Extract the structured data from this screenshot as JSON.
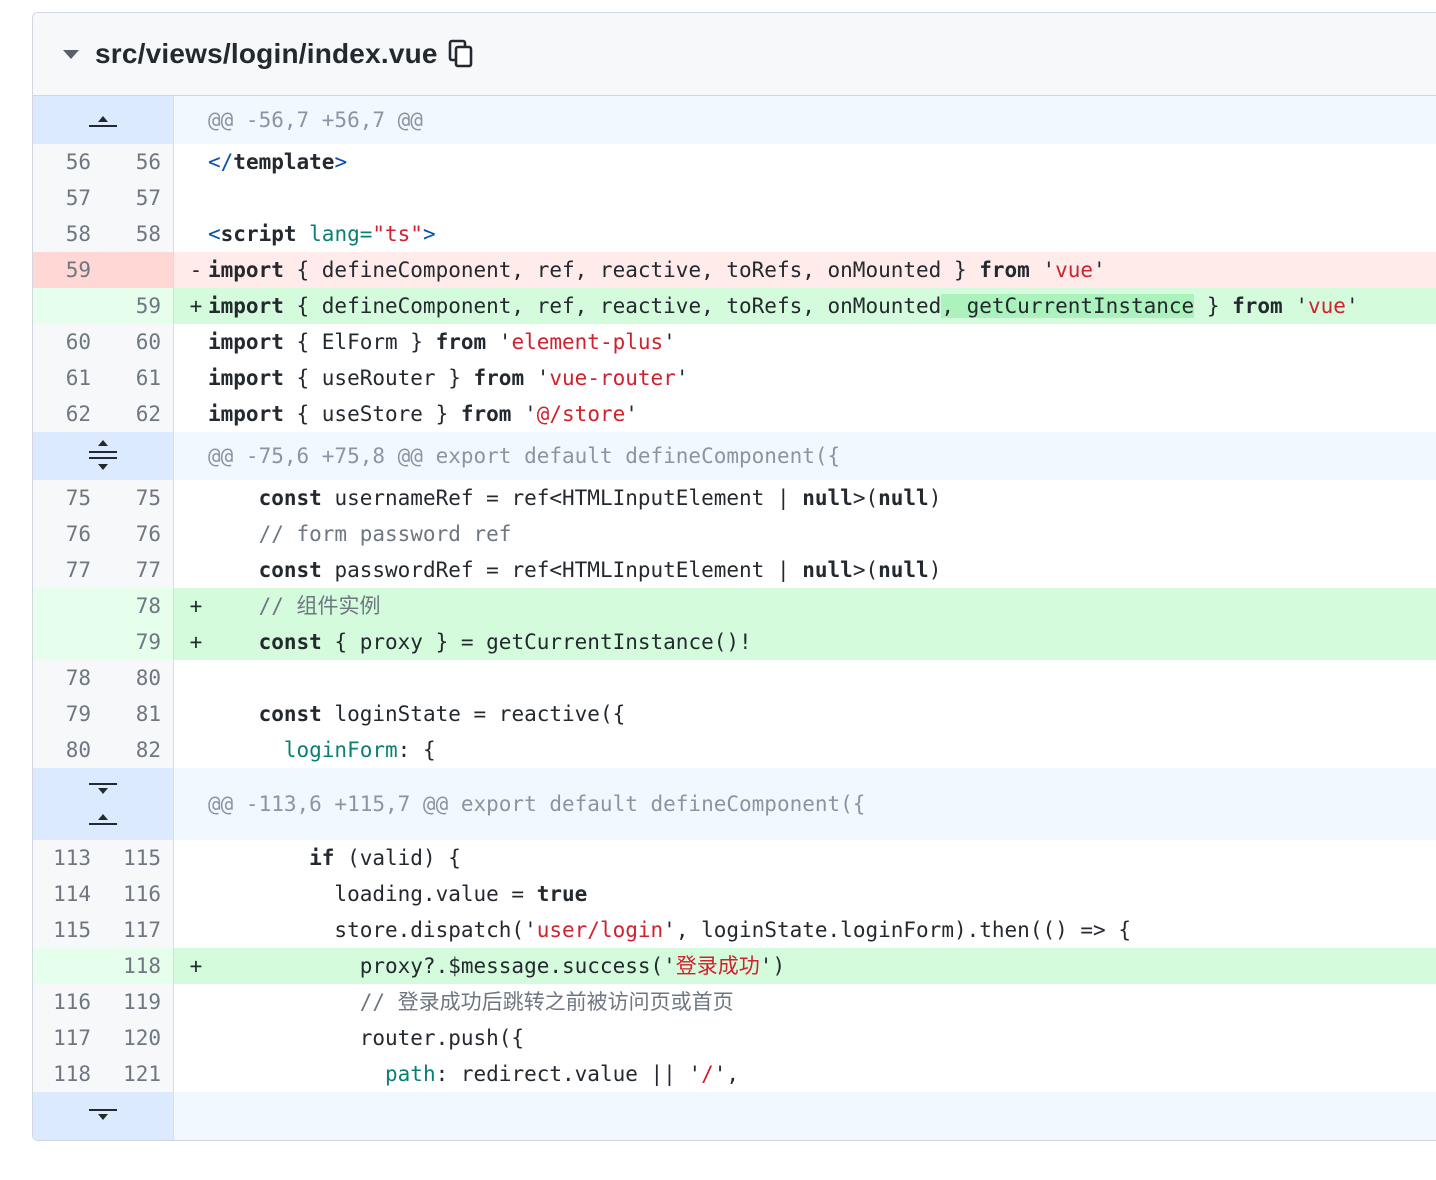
{
  "file": {
    "path": "src/views/login/index.vue",
    "hunks": {
      "h1": "@@ -56,7 +56,7 @@",
      "h2": "@@ -75,6 +75,8 @@ export default defineComponent({",
      "h3": "@@ -113,6 +115,7 @@ export default defineComponent({"
    },
    "lines": [
      {
        "old": "56",
        "new": "56"
      },
      {
        "old": "57",
        "new": "57"
      },
      {
        "old": "58",
        "new": "58"
      },
      {
        "old": "59",
        "new": ""
      },
      {
        "old": "",
        "new": "59"
      },
      {
        "old": "60",
        "new": "60"
      },
      {
        "old": "61",
        "new": "61"
      },
      {
        "old": "62",
        "new": "62"
      },
      {
        "old": "75",
        "new": "75"
      },
      {
        "old": "76",
        "new": "76"
      },
      {
        "old": "77",
        "new": "77"
      },
      {
        "old": "",
        "new": "78"
      },
      {
        "old": "",
        "new": "79"
      },
      {
        "old": "78",
        "new": "80"
      },
      {
        "old": "79",
        "new": "81"
      },
      {
        "old": "80",
        "new": "82"
      },
      {
        "old": "113",
        "new": "115"
      },
      {
        "old": "114",
        "new": "116"
      },
      {
        "old": "115",
        "new": "117"
      },
      {
        "old": "",
        "new": "118"
      },
      {
        "old": "116",
        "new": "119"
      },
      {
        "old": "117",
        "new": "120"
      },
      {
        "old": "118",
        "new": "121"
      }
    ],
    "code": {
      "l56_a": "</",
      "l56_b": "template",
      "l56_c": ">",
      "l58_a": "<",
      "l58_b": "script",
      "l58_c": " lang=",
      "l58_d": "\"ts\"",
      "l58_e": ">",
      "l59d_kw": "import",
      "l59d_mid": " { defineComponent, ref, reactive, toRefs, onMounted } ",
      "l59d_from": "from",
      "l59d_q1": " '",
      "l59d_str": "vue",
      "l59d_q2": "'",
      "l59a_kw": "import",
      "l59a_mid": " { defineComponent, ref, reactive, toRefs, onMounted",
      "l59a_hl": ", getCurrentInstance",
      "l59a_mid2": " } ",
      "l59a_from": "from",
      "l59a_q1": " '",
      "l59a_str": "vue",
      "l59a_q2": "'",
      "l60_kw": "import",
      "l60_mid": " { ElForm } ",
      "l60_from": "from",
      "l60_q1": " '",
      "l60_str": "element-plus",
      "l60_q2": "'",
      "l61_kw": "import",
      "l61_mid": " { useRouter } ",
      "l61_from": "from",
      "l61_q1": " '",
      "l61_str": "vue-router",
      "l61_q2": "'",
      "l62_kw": "import",
      "l62_mid": " { useStore } ",
      "l62_from": "from",
      "l62_q1": " '",
      "l62_str": "@/store",
      "l62_q2": "'",
      "l75_ind": "    ",
      "l75_kw": "const",
      "l75_mid": " usernameRef = ref<HTMLInputElement | ",
      "l75_null": "null",
      "l75_p": ">(",
      "l75_null2": "null",
      "l75_e": ")",
      "l76": "    // form password ref",
      "l77_ind": "    ",
      "l77_kw": "const",
      "l77_mid": " passwordRef = ref<HTMLInputElement | ",
      "l77_null": "null",
      "l77_p": ">(",
      "l77_null2": "null",
      "l77_e": ")",
      "l78n": "    // 组件实例",
      "l79n_ind": "    ",
      "l79n_kw": "const",
      "l79n_mid": " { proxy } = getCurrentInstance()!",
      "l81_ind": "    ",
      "l81_kw": "const",
      "l81_mid": " loginState = reactive({",
      "l82_ind": "      ",
      "l82_prop": "loginForm",
      "l82_mid": ": {",
      "l115_ind": "        ",
      "l115_kw": "if",
      "l115_mid": " (valid) {",
      "l116_ind": "          loading.value = ",
      "l116_kw": "true",
      "l117_a": "          store.dispatch('",
      "l117_str": "user/login",
      "l117_b": "', loginState.loginForm).then(() => {",
      "l118n_a": "            proxy?.$message.success('",
      "l118n_str": "登录成功",
      "l118n_b": "')",
      "l119": "            // 登录成功后跳转之前被访问页或首页",
      "l120": "            router.push({",
      "l121_ind": "              ",
      "l121_prop": "path",
      "l121_a": ": redirect.value || '",
      "l121_str": "/",
      "l121_b": "',"
    },
    "markers": {
      "del": "-",
      "add": "+"
    }
  }
}
